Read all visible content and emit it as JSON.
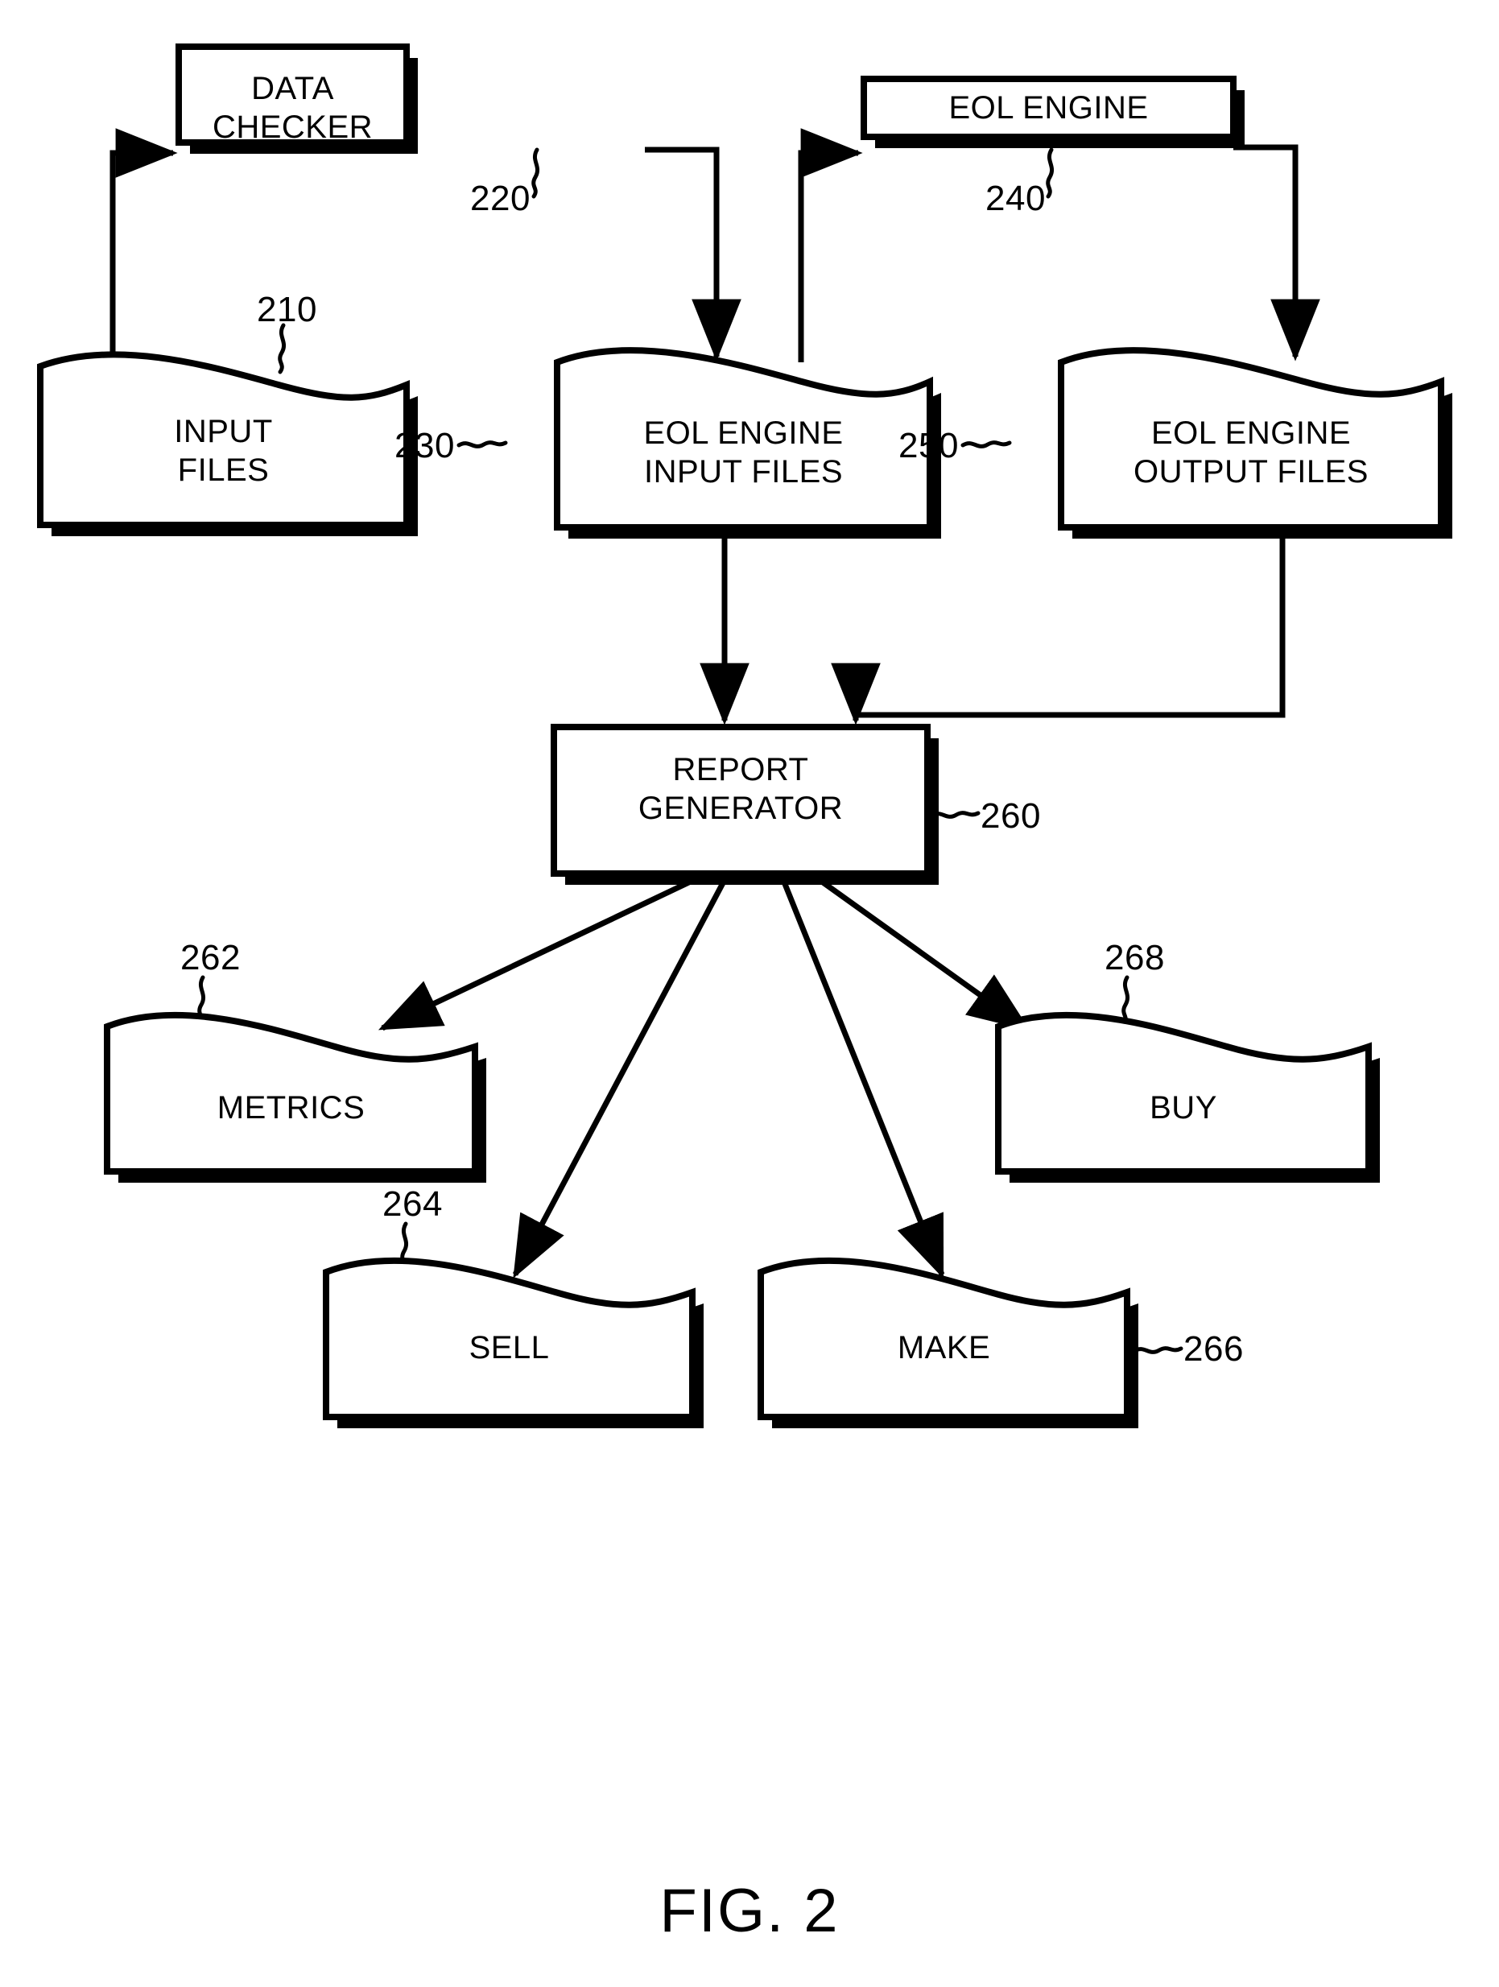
{
  "figure": {
    "caption": "FIG. 2",
    "nodes": [
      {
        "id": "data-checker",
        "label": "DATA\nCHECKER",
        "ref": "220",
        "shape": "process"
      },
      {
        "id": "eol-engine",
        "label": "EOL ENGINE",
        "ref": "240",
        "shape": "process"
      },
      {
        "id": "input-files",
        "label": "INPUT\nFILES",
        "ref": "210",
        "shape": "document"
      },
      {
        "id": "eol-input",
        "label": "EOL ENGINE\nINPUT FILES",
        "ref": "230",
        "shape": "document"
      },
      {
        "id": "eol-output",
        "label": "EOL ENGINE\nOUTPUT FILES",
        "ref": "250",
        "shape": "document"
      },
      {
        "id": "report-gen",
        "label": "REPORT\nGENERATOR",
        "ref": "260",
        "shape": "process"
      },
      {
        "id": "metrics",
        "label": "METRICS",
        "ref": "262",
        "shape": "document"
      },
      {
        "id": "sell",
        "label": "SELL",
        "ref": "264",
        "shape": "document"
      },
      {
        "id": "make",
        "label": "MAKE",
        "ref": "266",
        "shape": "document"
      },
      {
        "id": "buy",
        "label": "BUY",
        "ref": "268",
        "shape": "document"
      }
    ],
    "colors": {
      "stroke": "#000000",
      "fill": "#ffffff",
      "shadow": "#000000"
    }
  }
}
